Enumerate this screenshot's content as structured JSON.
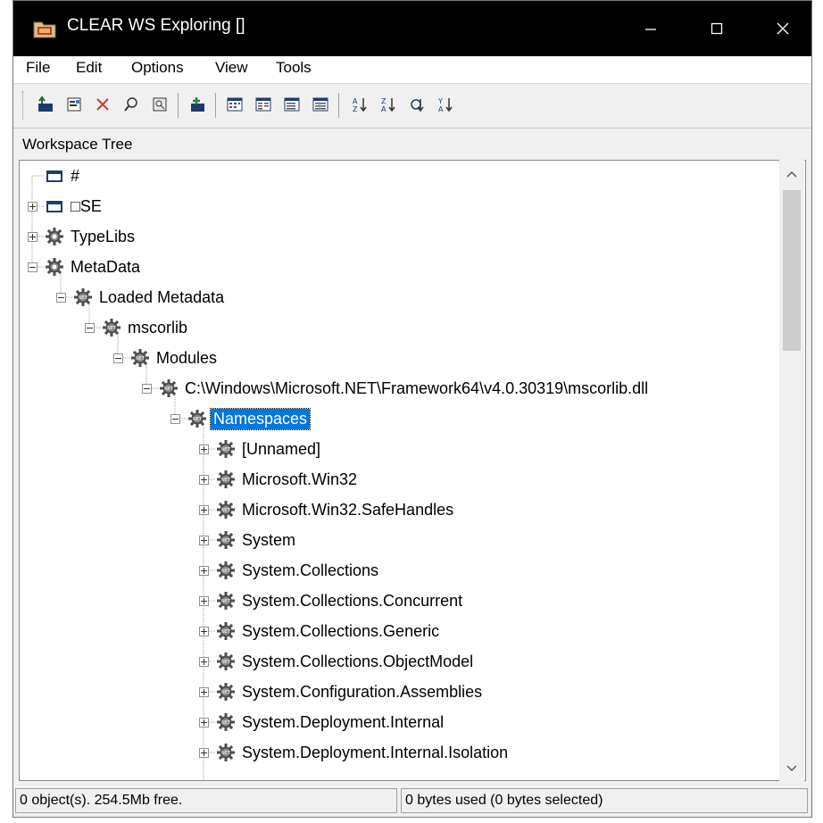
{
  "window": {
    "title": "CLEAR WS Exploring []",
    "controls": [
      "minimize-icon",
      "maximize-icon",
      "close-icon"
    ]
  },
  "menu": [
    "File",
    "Edit",
    "Options",
    "View",
    "Tools"
  ],
  "toolbar": {
    "buttons": [
      "up-level-icon",
      "properties-icon",
      "delete-icon",
      "find-icon",
      "view-icon",
      "new-item-icon",
      "large-icons-view-icon",
      "small-icons-view-icon",
      "list-view-icon",
      "details-view-icon",
      "sort-az-icon",
      "sort-za-icon",
      "refresh-icon",
      "sort-order-icon"
    ]
  },
  "panel": {
    "label": "Workspace Tree"
  },
  "tree": {
    "nodes": [
      {
        "label": "#",
        "icon": "window-icon",
        "expander": "none"
      },
      {
        "label": "□SE",
        "icon": "window-icon",
        "expander": "plus"
      },
      {
        "label": "TypeLibs",
        "icon": "gear-icon",
        "expander": "plus"
      },
      {
        "label": "MetaData",
        "icon": "gear-icon",
        "expander": "minus"
      },
      {
        "label": "Loaded Metadata",
        "icon": "net-gear-icon",
        "expander": "minus"
      },
      {
        "label": "mscorlib",
        "icon": "net-gear-icon",
        "expander": "minus"
      },
      {
        "label": "Modules",
        "icon": "net-gear-icon",
        "expander": "minus"
      },
      {
        "label": "C:\\Windows\\Microsoft.NET\\Framework64\\v4.0.30319\\mscorlib.dll",
        "icon": "net-gear-icon",
        "expander": "minus"
      },
      {
        "label": "Namespaces",
        "icon": "net-gear-icon",
        "expander": "minus",
        "selected": true
      },
      {
        "label": "[Unnamed]",
        "icon": "net-gear-icon",
        "expander": "plus"
      },
      {
        "label": "Microsoft.Win32",
        "icon": "net-gear-icon",
        "expander": "plus"
      },
      {
        "label": "Microsoft.Win32.SafeHandles",
        "icon": "net-gear-icon",
        "expander": "plus"
      },
      {
        "label": "System",
        "icon": "net-gear-icon",
        "expander": "plus"
      },
      {
        "label": "System.Collections",
        "icon": "net-gear-icon",
        "expander": "plus"
      },
      {
        "label": "System.Collections.Concurrent",
        "icon": "net-gear-icon",
        "expander": "plus"
      },
      {
        "label": "System.Collections.Generic",
        "icon": "net-gear-icon",
        "expander": "plus"
      },
      {
        "label": "System.Collections.ObjectModel",
        "icon": "net-gear-icon",
        "expander": "plus"
      },
      {
        "label": "System.Configuration.Assemblies",
        "icon": "net-gear-icon",
        "expander": "plus"
      },
      {
        "label": "System.Deployment.Internal",
        "icon": "net-gear-icon",
        "expander": "plus"
      },
      {
        "label": "System.Deployment.Internal.Isolation",
        "icon": "net-gear-icon",
        "expander": "plus"
      }
    ],
    "scroll_position": 0.05
  },
  "status": {
    "left": "0 object(s). 254.5Mb free.",
    "right": "0 bytes used (0 bytes selected)"
  },
  "colors": {
    "selection": "#0078d7",
    "titlebar": "#000000"
  }
}
